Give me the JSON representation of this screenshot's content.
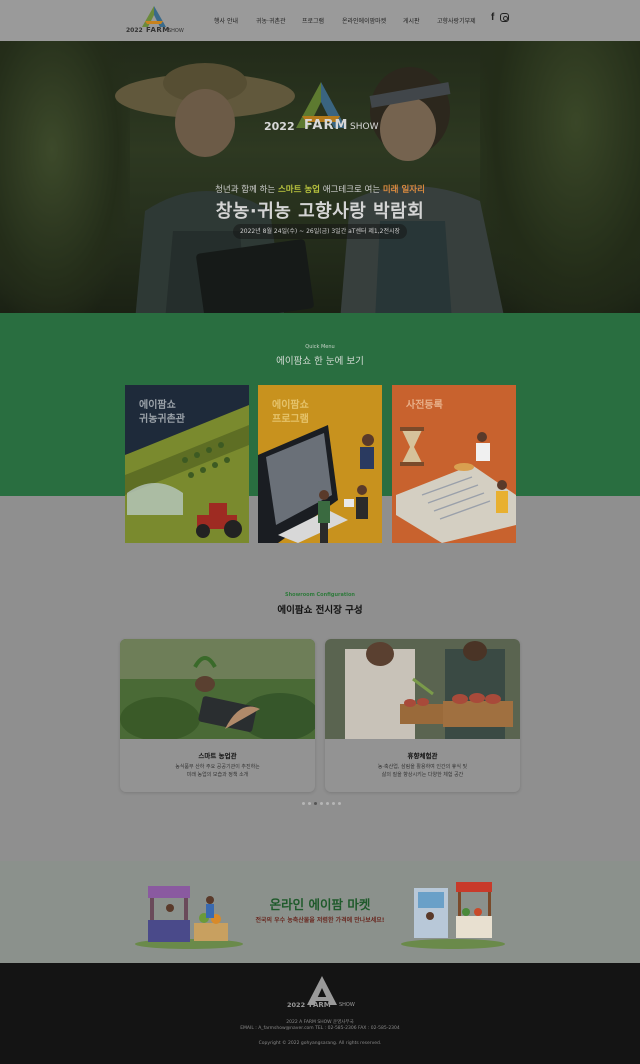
{
  "header": {
    "logo": {
      "year": "2022",
      "name": "FARM",
      "show": "SHOW"
    },
    "nav": [
      "행사 안내",
      "귀농·귀촌관",
      "프로그램",
      "온라인에이팜마켓",
      "게시판",
      "고향사랑기부제"
    ],
    "social": {
      "facebook": "f",
      "instagram": "instagram-icon"
    }
  },
  "hero": {
    "logo": {
      "year": "2022",
      "name": "FARM",
      "show": "SHOW"
    },
    "subtitle_pre": "청년과 함께 하는 ",
    "subtitle_hl1": "스마트 농업",
    "subtitle_mid": " 애그테크로 여는 ",
    "subtitle_hl2": "미래 일자리",
    "title": "창농·귀농 고향사랑 박람회",
    "date": "2022년 8월 24일(수) ~ 26일(금) 3일간 aT센터 제1,2전시장"
  },
  "quick": {
    "small": "Quick Menu",
    "title": "에이팜쇼 한 눈에 보기",
    "cards": [
      {
        "line1": "에이팜쇼",
        "line2": "귀농귀촌관"
      },
      {
        "line1": "에이팜쇼",
        "line2": "프로그램"
      },
      {
        "line1": "사전등록",
        "line2": ""
      }
    ]
  },
  "showroom": {
    "small": "Showroom Configuration",
    "title": "에이팜쇼 전시장 구성",
    "cards": [
      {
        "name": "스마트 농업관",
        "desc1": "농식품부 산하 주요 공공기관이 추진하는",
        "desc2": "미래 농업의 모습과 정책 소개"
      },
      {
        "name": "휴향체험관",
        "desc1": "농·축산업, 삼림을 활용하여 인간의 휴식 및",
        "desc2": "삶의 질을 향상시키는 다양한 체험 공간"
      }
    ],
    "dots": 7,
    "active_dot": 2
  },
  "market": {
    "title": "온라인 에이팜 마켓",
    "subtitle": "전국의 우수 농축산물을 저렴한 가격에 만나보세요!"
  },
  "footer": {
    "logo": {
      "year": "2022",
      "name": "FARM",
      "show": "SHOW"
    },
    "org": "2022 A FARM SHOW 운영사무국",
    "contact": "EMAIL : A_farmshow@naver.com     TEL : 02-585-2306     FAX : 02-585-2304",
    "copyright": "Copyright © 2022 gohyangsarang. All rights reserved."
  },
  "colors": {
    "green": "#296e40",
    "footer": "#141414",
    "accent_orange": "#d98a3e",
    "accent_lime": "#b9c43e"
  }
}
